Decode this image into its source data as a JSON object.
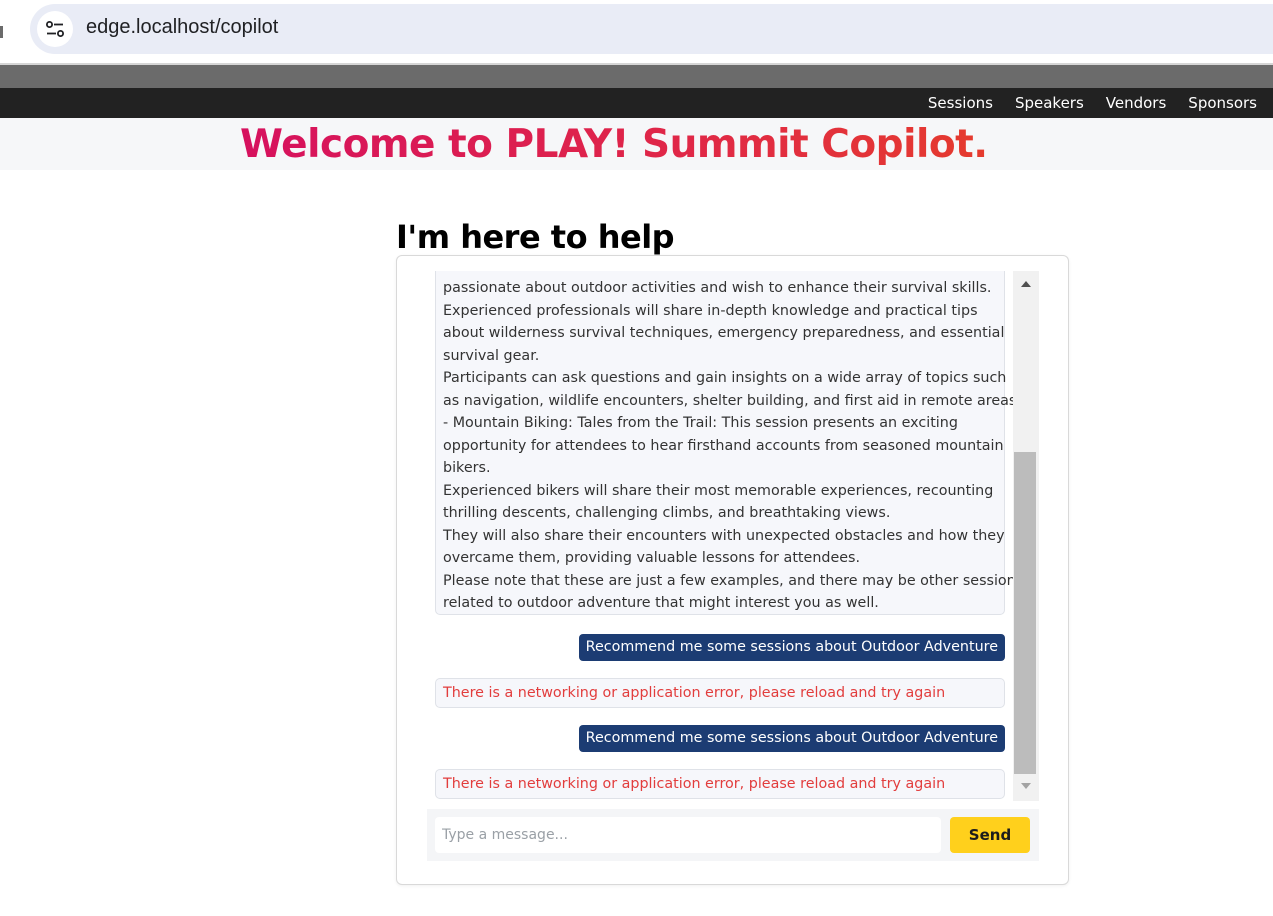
{
  "browser": {
    "url": "edge.localhost/copilot",
    "site_info_icon": "tune-icon"
  },
  "nav": {
    "items": [
      "Sessions",
      "Speakers",
      "Vendors",
      "Sponsors"
    ]
  },
  "header": {
    "title": "Welcome to PLAY! Summit Copilot.",
    "title_gradient": [
      "#d6115e",
      "#e53b2e"
    ]
  },
  "main": {
    "heading": "I'm here to help"
  },
  "chat": {
    "bot_long_lines": [
      "passionate about outdoor activities and wish to enhance their survival skills.",
      "Experienced professionals will share in-depth knowledge and practical tips",
      "about wilderness survival techniques, emergency preparedness, and essential",
      "survival gear.",
      "Participants can ask questions and gain insights on a wide array of topics such",
      "as navigation, wildlife encounters, shelter building, and first aid in remote areas.",
      "- Mountain Biking: Tales from the Trail: This session presents an exciting",
      "opportunity for attendees to hear firsthand accounts from seasoned mountain",
      "bikers.",
      "Experienced bikers will share their most memorable experiences, recounting",
      "thrilling descents, challenging climbs, and breathtaking views.",
      "They will also share their encounters with unexpected obstacles and how they",
      "overcame them, providing valuable lessons for attendees.",
      "Please note that these are just a few examples, and there may be other sessions",
      "related to outdoor adventure that might interest you as well."
    ],
    "user_message_1": "Recommend me some sessions about Outdoor Adventure",
    "error_message_1": "There is a networking or application error, please reload and try again",
    "user_message_2": "Recommend me some sessions about Outdoor Adventure",
    "error_message_2": "There is a networking or application error, please reload and try again",
    "input_placeholder": "Type a message...",
    "input_value": "",
    "send_label": "Send"
  },
  "colors": {
    "nav_bg": "#222222",
    "user_bubble": "#1c3c73",
    "error_text": "#e23d3d",
    "send_button": "#ffd01c"
  }
}
